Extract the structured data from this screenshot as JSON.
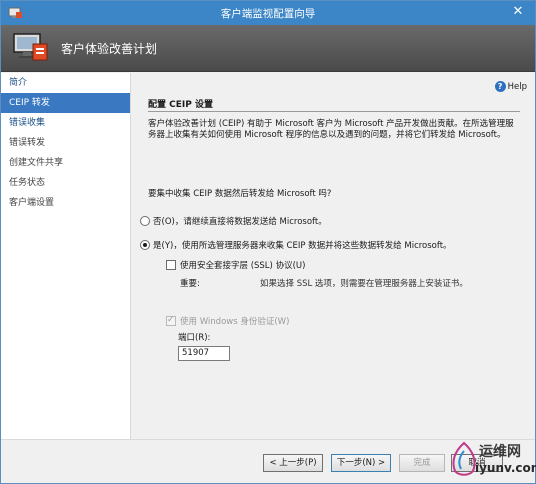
{
  "window": {
    "title": "客户端监视配置向导",
    "close_glyph": "✕"
  },
  "header": {
    "title": "客户体验改善计划"
  },
  "sidebar": {
    "items": [
      {
        "label": "简介",
        "state": "done"
      },
      {
        "label": "CEIP 转发",
        "state": "selected"
      },
      {
        "label": "错误收集",
        "state": "done"
      },
      {
        "label": "错误转发",
        "state": "normal"
      },
      {
        "label": "创建文件共享",
        "state": "normal"
      },
      {
        "label": "任务状态",
        "state": "normal"
      },
      {
        "label": "客户端设置",
        "state": "normal"
      }
    ]
  },
  "content": {
    "help_label": "Help",
    "section_title": "配置 CEIP 设置",
    "description": "客户体验改善计划 (CEIP) 有助于 Microsoft 客户为 Microsoft 产品开发做出贡献。在所选管理服务器上收集有关如何使用 Microsoft 程序的信息以及遇到的问题，并将它们转发给 Microsoft。",
    "question": "要集中收集 CEIP 数据然后转发给 Microsoft 吗?",
    "option_no": "否(O)，请继续直接将数据发送给 Microsoft。",
    "option_yes": "是(Y)，使用所选管理服务器来收集 CEIP 数据并将这些数据转发给 Microsoft。",
    "ssl_label": "使用安全套接字层 (SSL) 协议(U)",
    "important_label": "重要:",
    "important_text": "如果选择 SSL 选项，则需要在管理服务器上安装证书。",
    "windows_auth_label": "使用 Windows 身份验证(W)",
    "port_label": "端口(R):",
    "port_value": "51907"
  },
  "footer": {
    "back_label": "< 上一步(P)",
    "next_label": "下一步(N) >",
    "finish_label": "完成",
    "cancel_label": "取消"
  },
  "watermark": {
    "text": "运维网",
    "url": "iyunv.com"
  },
  "colors": {
    "titlebar": "#3c86c7",
    "selected": "#3a78c2",
    "header": "#555555"
  }
}
